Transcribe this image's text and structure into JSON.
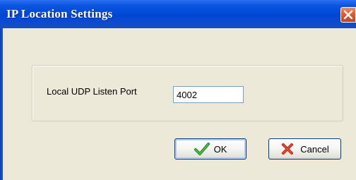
{
  "window": {
    "title": "IP Location Settings"
  },
  "settings": {
    "port_label": "Local UDP Listen Port",
    "port_value": "4002"
  },
  "buttons": {
    "ok_label": "OK",
    "cancel_label": "Cancel"
  },
  "icons": {
    "close": "close-icon",
    "ok": "check-icon",
    "cancel": "x-icon"
  },
  "colors": {
    "titlebar": "#0046d5",
    "window_bg": "#ece9d8",
    "close_button": "#e05a2c",
    "check": "#1f8a2e",
    "cancel_x": "#c0281c"
  }
}
